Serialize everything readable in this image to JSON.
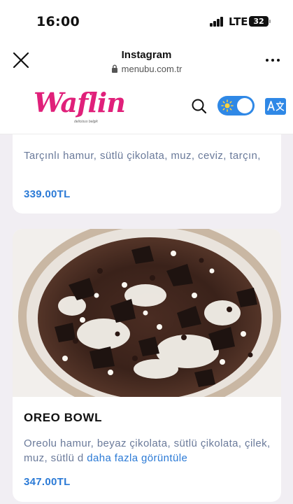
{
  "status_bar": {
    "time": "16:00",
    "network": "LTE",
    "battery": "32"
  },
  "browser": {
    "title": "Instagram",
    "url": "menubu.com.tr"
  },
  "site": {
    "logo": "Waflin",
    "logo_tagline": "delicious belgik"
  },
  "products": [
    {
      "description": "Tarçınlı hamur, sütlü çikolata, muz, ceviz, tarçın,",
      "price": "339.00TL"
    },
    {
      "name": "OREO BOWL",
      "description": "Oreolu hamur, beyaz çikolata, sütlü çikolata, çilek, muz, sütlü d",
      "more_link": "daha fazla görüntüle",
      "price": "347.00TL"
    }
  ],
  "colors": {
    "brand": "#e0207a",
    "accent": "#2b7ad6",
    "toggle": "#2f88e6"
  }
}
